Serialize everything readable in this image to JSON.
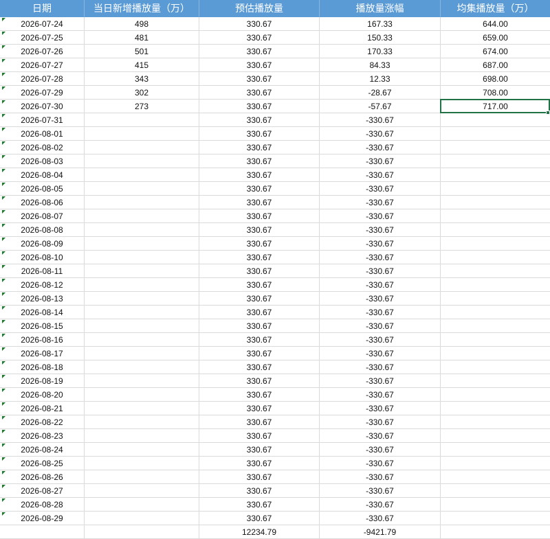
{
  "colors": {
    "header_background": "#5b9bd5",
    "header_text": "#ffffff",
    "gridline": "#dadada",
    "selection": "#217346",
    "text_number_indicator": "#1b7d2f"
  },
  "sheet": {
    "headers": [
      "日期",
      "当日新增播放量（万）",
      "预估播放量",
      "播放量涨幅",
      "均集播放量（万）"
    ],
    "rows": [
      [
        "2026-07-24",
        "498",
        "330.67",
        "167.33",
        "644.00"
      ],
      [
        "2026-07-25",
        "481",
        "330.67",
        "150.33",
        "659.00"
      ],
      [
        "2026-07-26",
        "501",
        "330.67",
        "170.33",
        "674.00"
      ],
      [
        "2026-07-27",
        "415",
        "330.67",
        "84.33",
        "687.00"
      ],
      [
        "2026-07-28",
        "343",
        "330.67",
        "12.33",
        "698.00"
      ],
      [
        "2026-07-29",
        "302",
        "330.67",
        "-28.67",
        "708.00"
      ],
      [
        "2026-07-30",
        "273",
        "330.67",
        "-57.67",
        "717.00"
      ],
      [
        "2026-07-31",
        "",
        "330.67",
        "-330.67",
        ""
      ],
      [
        "2026-08-01",
        "",
        "330.67",
        "-330.67",
        ""
      ],
      [
        "2026-08-02",
        "",
        "330.67",
        "-330.67",
        ""
      ],
      [
        "2026-08-03",
        "",
        "330.67",
        "-330.67",
        ""
      ],
      [
        "2026-08-04",
        "",
        "330.67",
        "-330.67",
        ""
      ],
      [
        "2026-08-05",
        "",
        "330.67",
        "-330.67",
        ""
      ],
      [
        "2026-08-06",
        "",
        "330.67",
        "-330.67",
        ""
      ],
      [
        "2026-08-07",
        "",
        "330.67",
        "-330.67",
        ""
      ],
      [
        "2026-08-08",
        "",
        "330.67",
        "-330.67",
        ""
      ],
      [
        "2026-08-09",
        "",
        "330.67",
        "-330.67",
        ""
      ],
      [
        "2026-08-10",
        "",
        "330.67",
        "-330.67",
        ""
      ],
      [
        "2026-08-11",
        "",
        "330.67",
        "-330.67",
        ""
      ],
      [
        "2026-08-12",
        "",
        "330.67",
        "-330.67",
        ""
      ],
      [
        "2026-08-13",
        "",
        "330.67",
        "-330.67",
        ""
      ],
      [
        "2026-08-14",
        "",
        "330.67",
        "-330.67",
        ""
      ],
      [
        "2026-08-15",
        "",
        "330.67",
        "-330.67",
        ""
      ],
      [
        "2026-08-16",
        "",
        "330.67",
        "-330.67",
        ""
      ],
      [
        "2026-08-17",
        "",
        "330.67",
        "-330.67",
        ""
      ],
      [
        "2026-08-18",
        "",
        "330.67",
        "-330.67",
        ""
      ],
      [
        "2026-08-19",
        "",
        "330.67",
        "-330.67",
        ""
      ],
      [
        "2026-08-20",
        "",
        "330.67",
        "-330.67",
        ""
      ],
      [
        "2026-08-21",
        "",
        "330.67",
        "-330.67",
        ""
      ],
      [
        "2026-08-22",
        "",
        "330.67",
        "-330.67",
        ""
      ],
      [
        "2026-08-23",
        "",
        "330.67",
        "-330.67",
        ""
      ],
      [
        "2026-08-24",
        "",
        "330.67",
        "-330.67",
        ""
      ],
      [
        "2026-08-25",
        "",
        "330.67",
        "-330.67",
        ""
      ],
      [
        "2026-08-26",
        "",
        "330.67",
        "-330.67",
        ""
      ],
      [
        "2026-08-27",
        "",
        "330.67",
        "-330.67",
        ""
      ],
      [
        "2026-08-28",
        "",
        "330.67",
        "-330.67",
        ""
      ],
      [
        "2026-08-29",
        "",
        "330.67",
        "-330.67",
        ""
      ]
    ],
    "totals": [
      "",
      "",
      "12234.79",
      "-9421.79",
      ""
    ],
    "selected": {
      "date": "2026-07-30",
      "column": "均集播放量（万）"
    }
  }
}
